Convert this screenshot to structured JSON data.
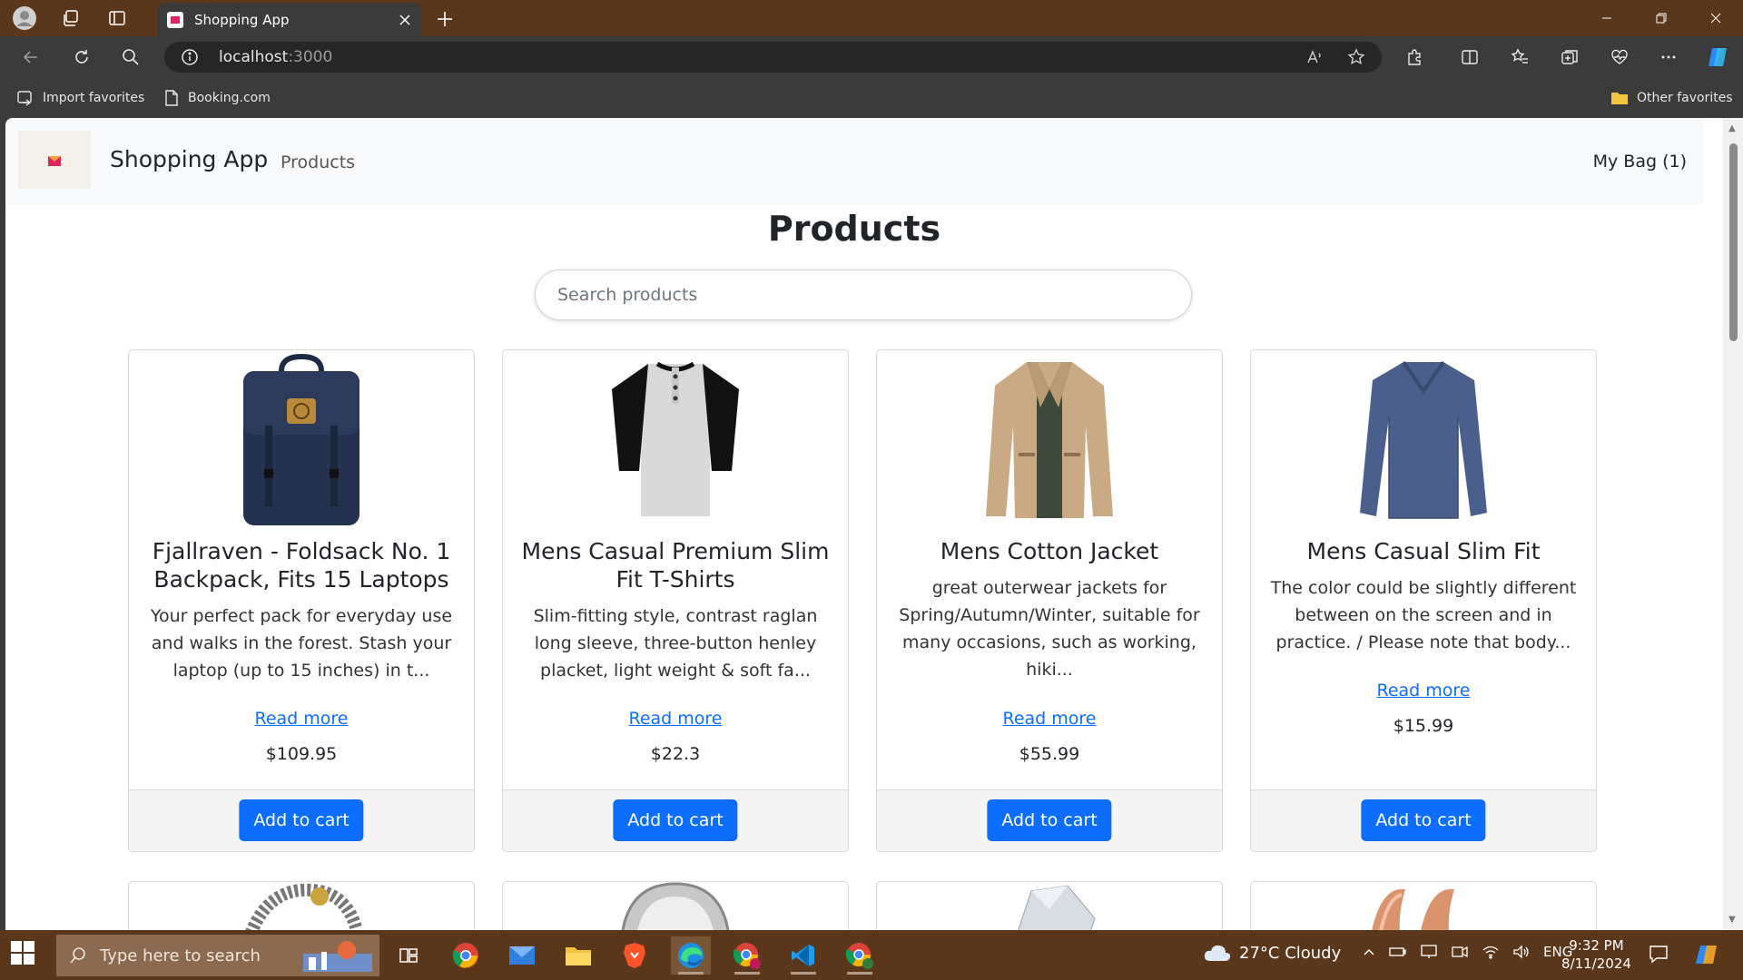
{
  "browser": {
    "tab_title": "Shopping App",
    "url_host": "localhost",
    "url_port": ":3000",
    "bookmarks": [
      "Import favorites",
      "Booking.com"
    ],
    "other_favorites": "Other favorites"
  },
  "site": {
    "brand": "Shopping App",
    "nav_products": "Products",
    "my_bag": "My Bag (1)",
    "heading": "Products",
    "search_placeholder": "Search products"
  },
  "products": [
    {
      "title": "Fjallraven - Foldsack No. 1 Backpack, Fits 15 Laptops",
      "description": "Your perfect pack for everyday use and walks in the forest. Stash your laptop (up to 15 inches) in t...",
      "read_more": "Read more",
      "price": "$109.95",
      "button": "Add to cart"
    },
    {
      "title": "Mens Casual Premium Slim Fit T-Shirts",
      "description": "Slim-fitting style, contrast raglan long sleeve, three-button henley placket, light weight & soft fa...",
      "read_more": "Read more",
      "price": "$22.3",
      "button": "Add to cart"
    },
    {
      "title": "Mens Cotton Jacket",
      "description": "great outerwear jackets for Spring/Autumn/Winter, suitable for many occasions, such as working, hiki...",
      "read_more": "Read more",
      "price": "$55.99",
      "button": "Add to cart"
    },
    {
      "title": "Mens Casual Slim Fit",
      "description": "The color could be slightly different between on the screen and in practice. / Please note that body...",
      "read_more": "Read more",
      "price": "$15.99",
      "button": "Add to cart"
    }
  ],
  "taskbar": {
    "search_placeholder": "Type here to search",
    "weather": "27°C  Cloudy",
    "lang": "ENG",
    "time": "9:32 PM",
    "date": "8/11/2024"
  },
  "colors": {
    "accent": "#0d6efd",
    "titlebar": "#5a361b",
    "chrome": "#3b3b3b"
  }
}
